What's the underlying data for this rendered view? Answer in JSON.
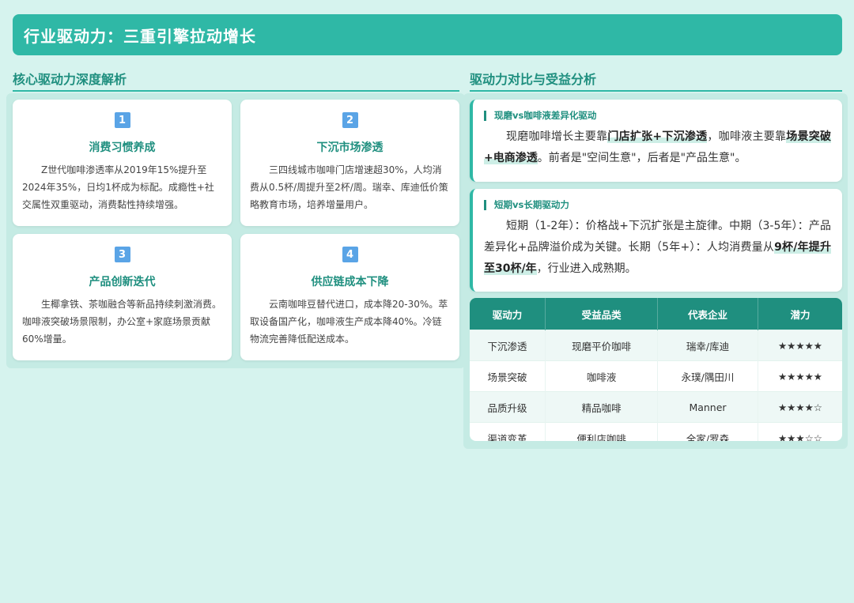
{
  "header": {
    "title": "行业驱动力：三重引擎拉动增长"
  },
  "left_section": {
    "heading": "核心驱动力深度解析",
    "cards": [
      {
        "num": "1",
        "title": "消费习惯养成",
        "body": "Z世代咖啡渗透率从2019年15%提升至2024年35%，日均1杯成为标配。成瘾性+社交属性双重驱动，消费黏性持续增强。"
      },
      {
        "num": "2",
        "title": "下沉市场渗透",
        "body": "三四线城市咖啡门店增速超30%，人均消费从0.5杯/周提升至2杯/周。瑞幸、库迪低价策略教育市场，培养增量用户。"
      },
      {
        "num": "3",
        "title": "产品创新迭代",
        "body": "生椰拿铁、茶咖融合等新品持续刺激消费。咖啡液突破场景限制，办公室+家庭场景贡献60%增量。"
      },
      {
        "num": "4",
        "title": "供应链成本下降",
        "body": "云南咖啡豆替代进口，成本降20-30%。萃取设备国产化，咖啡液生产成本降40%。冷链物流完善降低配送成本。"
      }
    ]
  },
  "right_section": {
    "heading": "驱动力对比与受益分析",
    "card1": {
      "title": "现磨vs咖啡液差异化驱动",
      "t1": "现磨咖啡增长主要靠",
      "h1": "门店扩张+下沉渗透",
      "t2": "，咖啡液主要靠",
      "h2": "场景突破+电商渗透",
      "t3": "。前者是\"空间生意\"，后者是\"产品生意\"。"
    },
    "card2": {
      "title": "短期vs长期驱动力",
      "t1": "短期（1-2年）：价格战+下沉扩张是主旋律。中期（3-5年）：产品差异化+品牌溢价成为关键。长期（5年+）：人均消费量从",
      "h1": "9杯/年提升至30杯/年",
      "t2": "，行业进入成熟期。"
    },
    "table": {
      "headers": [
        "驱动力",
        "受益品类",
        "代表企业",
        "潜力"
      ],
      "rows": [
        [
          "下沉渗透",
          "现磨平价咖啡",
          "瑞幸/库迪",
          "★★★★★"
        ],
        [
          "场景突破",
          "咖啡液",
          "永璞/隅田川",
          "★★★★★"
        ],
        [
          "品质升级",
          "精品咖啡",
          "Manner",
          "★★★★☆"
        ],
        [
          "渠道变革",
          "便利店咖啡",
          "全家/罗森",
          "★★★☆☆"
        ]
      ]
    }
  },
  "colors": {
    "accent": "#2fb8a6",
    "accent_dark": "#1f8f7f",
    "background": "#d6f3ee",
    "number_badge": "#5aa4e6"
  }
}
